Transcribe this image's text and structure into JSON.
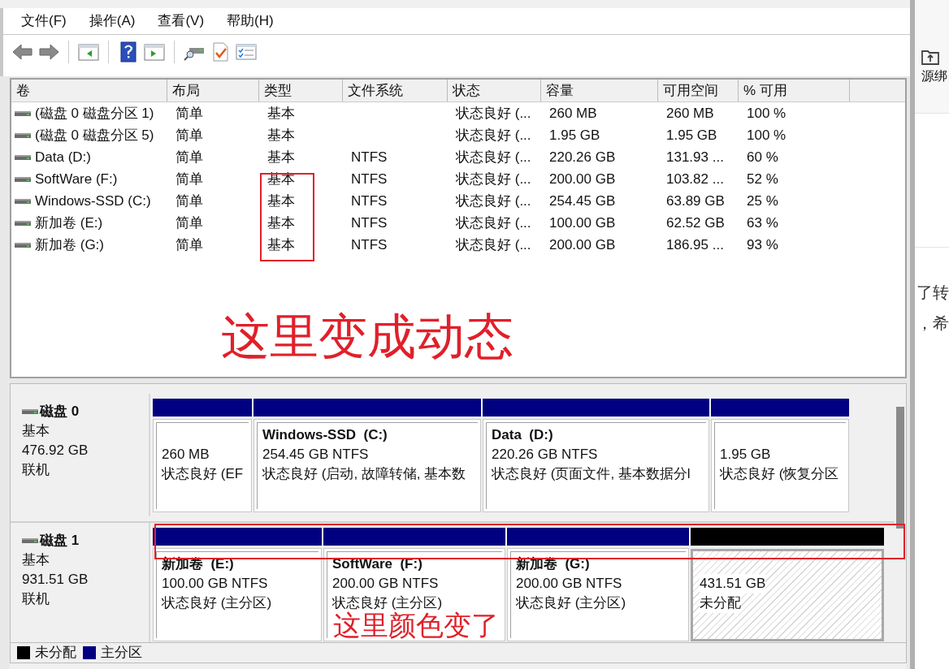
{
  "menu": [
    "文件(F)",
    "操作(A)",
    "查看(V)",
    "帮助(H)"
  ],
  "volumes": {
    "columns": [
      "卷",
      "布局",
      "类型",
      "文件系统",
      "状态",
      "容量",
      "可用空间",
      "% 可用"
    ],
    "rows": [
      {
        "cells": [
          "(磁盘 0 磁盘分区 1)",
          "简单",
          "基本",
          "",
          "状态良好 (...",
          "260 MB",
          "260 MB",
          "100 %"
        ]
      },
      {
        "cells": [
          "(磁盘 0 磁盘分区 5)",
          "简单",
          "基本",
          "",
          "状态良好 (...",
          "1.95 GB",
          "1.95 GB",
          "100 %"
        ]
      },
      {
        "cells": [
          "Data (D:)",
          "简单",
          "基本",
          "NTFS",
          "状态良好 (...",
          "220.26 GB",
          "131.93 ...",
          "60 %"
        ]
      },
      {
        "cells": [
          "SoftWare (F:)",
          "简单",
          "基本",
          "NTFS",
          "状态良好 (...",
          "200.00 GB",
          "103.82 ...",
          "52 %"
        ]
      },
      {
        "cells": [
          "Windows-SSD (C:)",
          "简单",
          "基本",
          "NTFS",
          "状态良好 (...",
          "254.45 GB",
          "63.89 GB",
          "25 %"
        ]
      },
      {
        "cells": [
          "新加卷 (E:)",
          "简单",
          "基本",
          "NTFS",
          "状态良好 (...",
          "100.00 GB",
          "62.52 GB",
          "63 %"
        ]
      },
      {
        "cells": [
          "新加卷 (G:)",
          "简单",
          "基本",
          "NTFS",
          "状态良好 (...",
          "200.00 GB",
          "186.95 ...",
          "93 %"
        ]
      }
    ]
  },
  "disks": [
    {
      "name": "磁盘 0",
      "type": "基本",
      "size": "476.92 GB",
      "status": "联机",
      "partitions": [
        {
          "kind": "primary",
          "color": "#000080",
          "size": "260 MB",
          "status": "状态良好 (EF"
        },
        {
          "kind": "primary",
          "color": "#000080",
          "title": "Windows-SSD  (C:)",
          "size": "254.45 GB NTFS",
          "status": "状态良好 (启动, 故障转储, 基本数"
        },
        {
          "kind": "primary",
          "color": "#000080",
          "title": "Data  (D:)",
          "size": "220.26 GB NTFS",
          "status": "状态良好 (页面文件, 基本数据分l"
        },
        {
          "kind": "primary",
          "color": "#000080",
          "size": "1.95 GB",
          "status": "状态良好 (恢复分区"
        }
      ]
    },
    {
      "name": "磁盘 1",
      "type": "基本",
      "size": "931.51 GB",
      "status": "联机",
      "partitions": [
        {
          "kind": "primary",
          "color": "#000080",
          "title": "新加卷  (E:)",
          "size": "100.00 GB NTFS",
          "status": "状态良好 (主分区)"
        },
        {
          "kind": "primary",
          "color": "#000080",
          "title": "SoftWare  (F:)",
          "size": "200.00 GB NTFS",
          "status": "状态良好 (主分区)"
        },
        {
          "kind": "primary",
          "color": "#000080",
          "title": "新加卷  (G:)",
          "size": "200.00 GB NTFS",
          "status": "状态良好 (主分区)"
        },
        {
          "kind": "unallocated",
          "color": "#000000",
          "size": "431.51 GB",
          "status": "未分配"
        }
      ]
    }
  ],
  "legend": [
    {
      "label": "未分配",
      "color": "#000000"
    },
    {
      "label": "主分区",
      "color": "#000080"
    }
  ],
  "annotations": [
    {
      "kind": "box"
    },
    {
      "kind": "text",
      "text": "这里变成动态"
    },
    {
      "kind": "box"
    },
    {
      "kind": "text",
      "text": "这里颜色变了"
    }
  ],
  "background_page": {
    "button": "源绑",
    "lines": [
      "了转",
      "，希"
    ]
  }
}
